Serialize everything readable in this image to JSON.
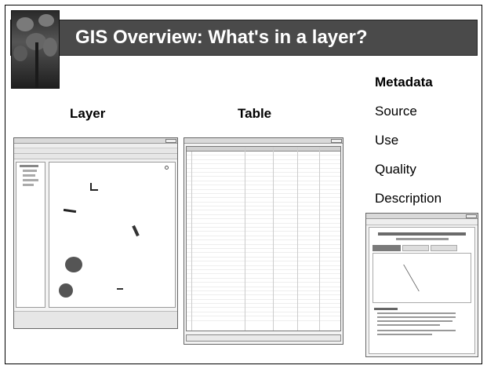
{
  "slide": {
    "title": "GIS Overview: What's in a layer?",
    "headings": {
      "layer": "Layer",
      "table": "Table"
    },
    "metadata": {
      "heading": "Metadata",
      "items": [
        "Source",
        "Use",
        "Quality",
        "Description"
      ]
    }
  },
  "colors": {
    "title_bar": "#4a4a4a",
    "title_text": "#ffffff",
    "slide_border": "#000000"
  }
}
